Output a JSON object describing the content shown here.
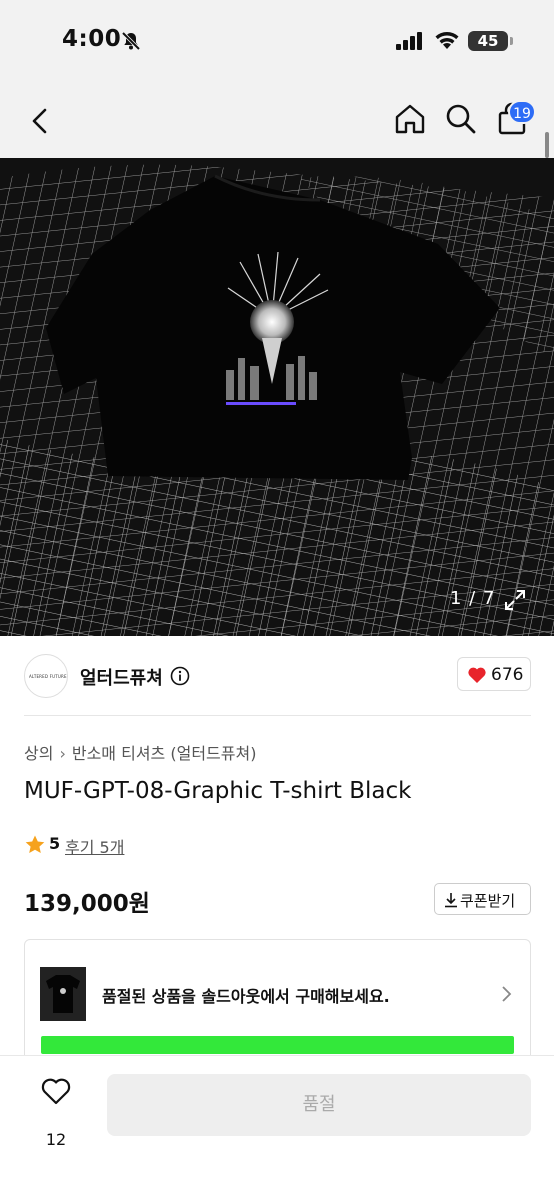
{
  "status_bar": {
    "time": "4:00",
    "battery": "45"
  },
  "nav": {
    "cart_count": "19"
  },
  "gallery": {
    "counter": "1 / 7"
  },
  "brand": {
    "name": "얼터드퓨쳐",
    "logo_text": "ALTERED FUTURE",
    "likes": "676"
  },
  "breadcrumb": {
    "items": [
      "상의",
      "반소매 티셔츠 (얼터드퓨쳐)"
    ]
  },
  "product": {
    "title": "MUF-GPT-08-Graphic T-shirt Black",
    "rating": "5",
    "reviews": "후기 5개",
    "price": "139,000원",
    "coupon_label": "쿠폰받기"
  },
  "soldout_banner": {
    "message": "품절된 상품을 솔드아웃에서 구매해보세요."
  },
  "bottom_bar": {
    "wish_count": "12",
    "buy_label": "품절"
  },
  "colors": {
    "accent": "#2d6cf6",
    "heart": "#e8242b",
    "banner_green": "#33e83a"
  }
}
